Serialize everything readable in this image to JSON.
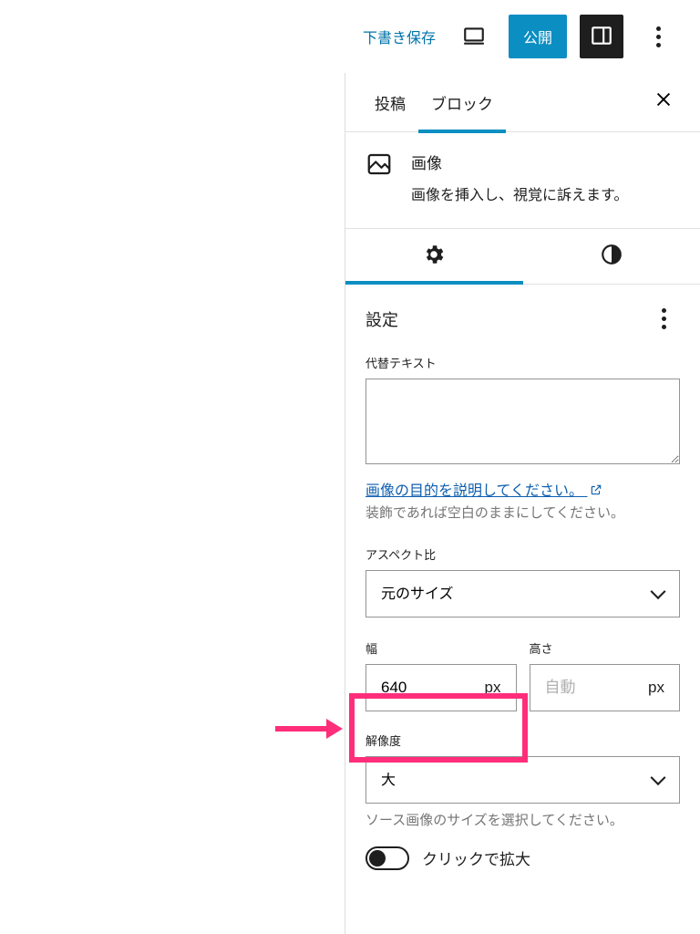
{
  "topbar": {
    "save_draft": "下書き保存",
    "publish": "公開"
  },
  "tabs": {
    "post": "投稿",
    "block": "ブロック"
  },
  "block": {
    "title": "画像",
    "desc": "画像を挿入し、視覚に訴えます。"
  },
  "section": {
    "settings_title": "設定",
    "alt_label": "代替テキスト",
    "alt_value": "",
    "alt_help_link": "画像の目的を説明してください。",
    "alt_help_text": "装飾であれば空白のままにしてください。",
    "aspect_label": "アスペクト比",
    "aspect_value": "元のサイズ",
    "width_label": "幅",
    "width_value": "640",
    "width_unit": "px",
    "height_label": "高さ",
    "height_placeholder": "自動",
    "height_value": "",
    "height_unit": "px",
    "resolution_label": "解像度",
    "resolution_value": "大",
    "resolution_help": "ソース画像のサイズを選択してください。",
    "click_zoom": "クリックで拡大"
  }
}
